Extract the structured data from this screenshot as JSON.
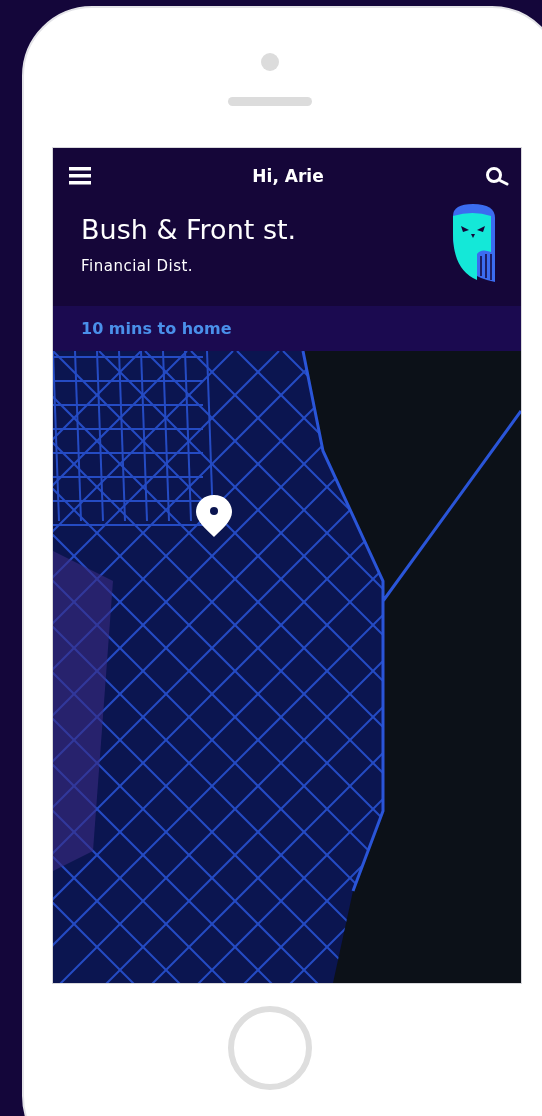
{
  "header": {
    "title": "Hi, Arie"
  },
  "location": {
    "street": "Bush & Front st.",
    "district": "Financial Dist."
  },
  "eta": {
    "text": "10 mins to home"
  }
}
